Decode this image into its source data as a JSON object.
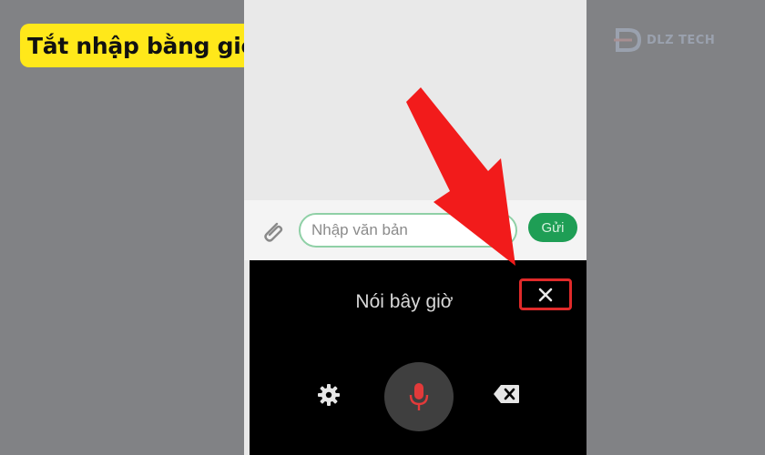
{
  "caption": {
    "text": "Tắt nhập bằng giọng nói"
  },
  "watermark": {
    "text": "DLZ TECH"
  },
  "chat": {
    "input_placeholder": "Nhập văn bản",
    "send_label": "Gửi"
  },
  "voice": {
    "prompt": "Nói bây giờ",
    "close_icon": "close-icon",
    "settings_icon": "gear-icon",
    "mic_icon": "microphone-icon",
    "backspace_icon": "backspace-icon"
  },
  "colors": {
    "caption_bg": "#ffe81a",
    "send_button": "#1e9e55",
    "input_border": "#8fd0a6",
    "mic": "#e23a3a",
    "highlight": "#e02a2a",
    "panel_bg": "#000000"
  }
}
